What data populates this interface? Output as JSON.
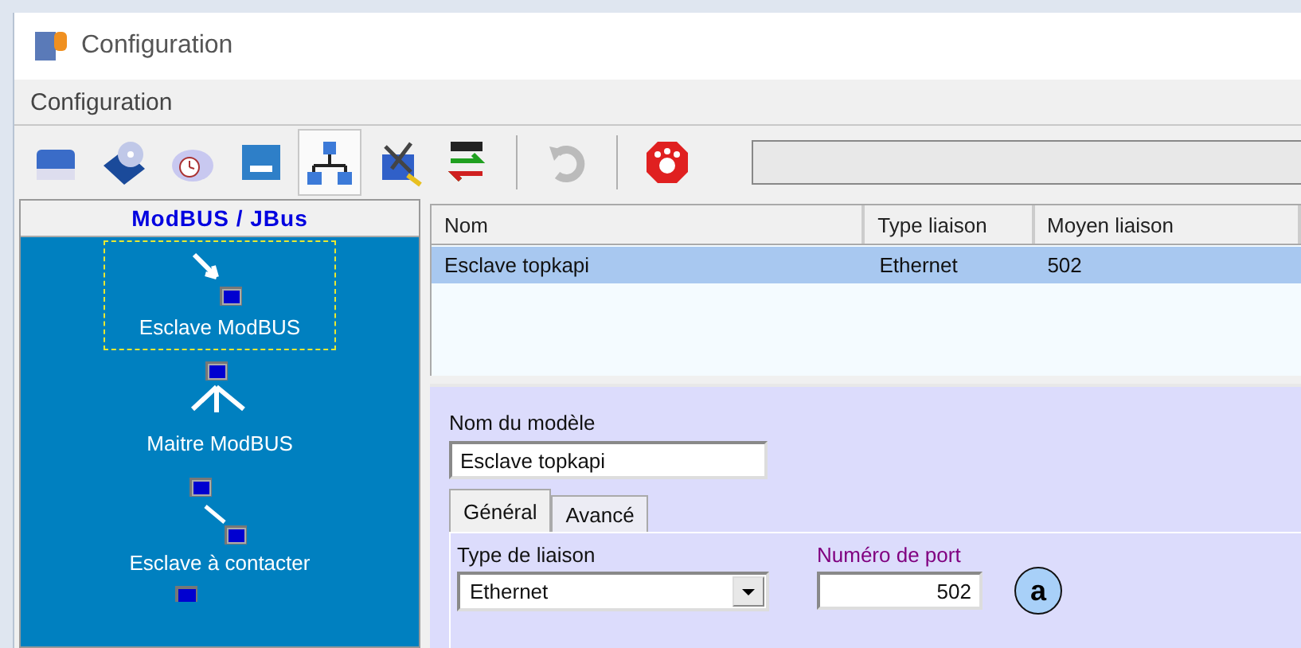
{
  "window": {
    "title": "Configuration"
  },
  "menu": [
    "Configuration"
  ],
  "toolbar": [
    {
      "kind": "button",
      "selected": false,
      "disabled": false
    },
    {
      "kind": "button",
      "selected": false,
      "disabled": false
    },
    {
      "kind": "button",
      "selected": false,
      "disabled": false
    },
    {
      "kind": "button",
      "selected": false,
      "disabled": false
    },
    {
      "kind": "button",
      "selected": true,
      "disabled": false
    },
    {
      "kind": "button",
      "selected": false,
      "disabled": false
    },
    {
      "kind": "button",
      "selected": false,
      "disabled": false
    },
    {
      "kind": "separator"
    },
    {
      "kind": "button",
      "selected": false,
      "disabled": true
    },
    {
      "kind": "separator"
    },
    {
      "kind": "button",
      "selected": false,
      "disabled": false
    },
    {
      "kind": "field"
    }
  ],
  "sidebar": {
    "title": "ModBUS / JBus",
    "items": [
      {
        "label": "Esclave ModBUS",
        "selected": true
      },
      {
        "label": "Maitre ModBUS",
        "selected": false
      },
      {
        "label": "Esclave à contacter",
        "selected": false
      }
    ]
  },
  "table": {
    "columns": [
      "Nom",
      "Type liaison",
      "Moyen liaison"
    ],
    "rows": [
      {
        "cells": [
          "Esclave topkapi",
          "Ethernet",
          "502"
        ],
        "selected": true
      }
    ]
  },
  "form": {
    "name_label": "Nom du modèle",
    "name_value": "Esclave topkapi",
    "tabs": [
      {
        "label": "Général",
        "selected": true
      },
      {
        "label": "Avancé",
        "selected": false
      }
    ],
    "link_type_label": "Type de liaison",
    "link_type_value": "Ethernet",
    "port_label": "Numéro de port",
    "port_value": "502",
    "annotation": "a"
  }
}
